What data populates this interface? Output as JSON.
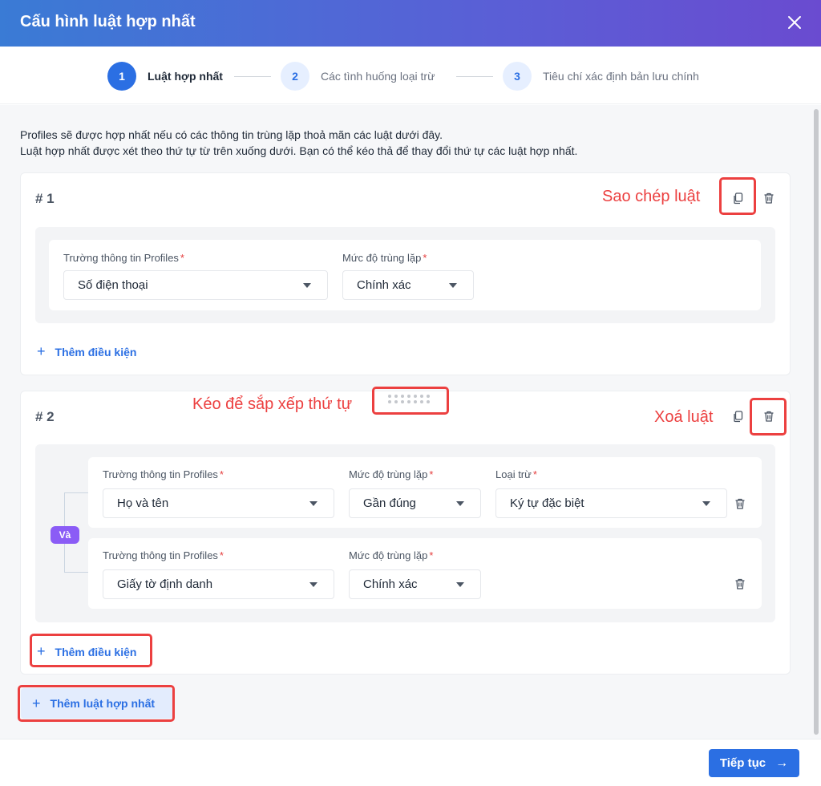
{
  "header": {
    "title": "Cấu hình luật hợp nhất"
  },
  "stepper": [
    {
      "number": "1",
      "label": "Luật hợp nhất"
    },
    {
      "number": "2",
      "label": "Các tình huống loại trừ"
    },
    {
      "number": "3",
      "label": "Tiêu chí xác định bản lưu chính"
    }
  ],
  "description": {
    "line1": "Profiles sẽ được hợp nhất nếu có các thông tin trùng lặp thoả mãn các luật dưới đây.",
    "line2": "Luật hợp nhất được xét theo thứ tự từ trên xuống dưới. Bạn có thể kéo thả để thay đổi thứ tự các luật hợp nhất."
  },
  "rules": [
    {
      "number": "# 1",
      "conditions": [
        {
          "field_label": "Trường thông tin Profiles",
          "field_value": "Số điện thoại",
          "match_label": "Mức độ trùng lặp",
          "match_value": "Chính xác"
        }
      ],
      "add_condition": "Thêm điều kiện"
    },
    {
      "number": "# 2",
      "connector": "Và",
      "conditions": [
        {
          "field_label": "Trường thông tin Profiles",
          "field_value": "Họ và tên",
          "match_label": "Mức độ trùng lặp",
          "match_value": "Gần đúng",
          "exclude_label": "Loại trừ",
          "exclude_value": "Ký tự đặc biệt"
        },
        {
          "field_label": "Trường thông tin Profiles",
          "field_value": "Giấy tờ định danh",
          "match_label": "Mức độ trùng lặp",
          "match_value": "Chính xác"
        }
      ],
      "add_condition": "Thêm điều kiện"
    }
  ],
  "add_rule": "Thêm luật hợp nhất",
  "footer": {
    "next_label": "Tiếp tục"
  },
  "annotations": {
    "copy_rule": "Sao chép luật",
    "drag_to_reorder": "Kéo để sắp xếp thứ tự",
    "delete_rule": "Xoá luật"
  },
  "colors": {
    "primary": "#2b6fe3",
    "annotation_red": "#ec4040",
    "and_badge": "#8b5cf6",
    "required": "#e53e3e"
  },
  "icons": [
    "close-icon",
    "copy-icon",
    "trash-icon",
    "drag-handle-icon",
    "plus-icon",
    "arrow-right-icon",
    "caret-down-icon"
  ]
}
